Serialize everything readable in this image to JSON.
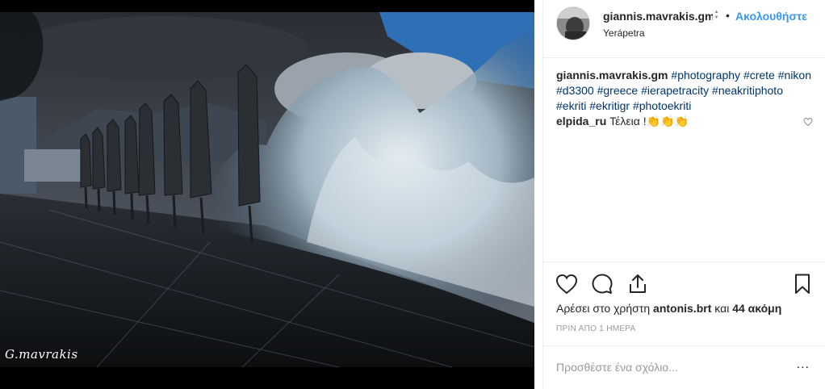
{
  "post": {
    "watermark": "G.mavrakis"
  },
  "header": {
    "username": "giannis.mavrakis.gm",
    "dot": "•",
    "follow_label": "Ακολουθήστε",
    "location": "Yerápetra"
  },
  "caption": {
    "user": "giannis.mavrakis.gm",
    "tags": [
      "#photography",
      "#crete",
      "#nikon",
      "#d3300",
      "#greece",
      "#ierapetracity",
      "#neakritiphoto",
      "#ekriti",
      "#ekritigr",
      "#photoekriti"
    ]
  },
  "comment": {
    "user": "elpida_ru",
    "text": "Τέλεια !",
    "emoji": "👏👏👏"
  },
  "likes": {
    "prefix": "Αρέσει στο χρήστη",
    "user": "antonis.brt",
    "middle": "και",
    "count": "44 ακόμη"
  },
  "timestamp": "ΠΡΙΝ ΑΠΟ 1 ΗΜΕΡΑ",
  "add_comment": {
    "placeholder": "Προσθέστε ένα σχόλιο...",
    "more": "..."
  },
  "icons": {
    "like": "heart-icon",
    "comment": "comment-bubble-icon",
    "share": "share-icon",
    "save": "bookmark-icon",
    "comment_like": "heart-outline-icon"
  },
  "colors": {
    "link": "#3897f0",
    "hashtag": "#003569",
    "muted": "#999999"
  }
}
